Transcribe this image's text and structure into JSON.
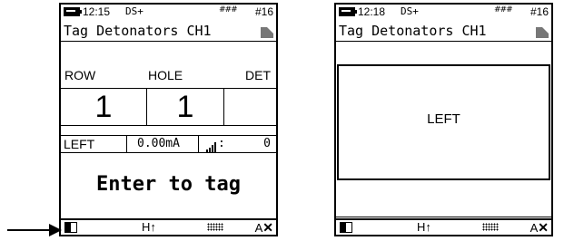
{
  "screen1": {
    "status": {
      "time": "12:15",
      "mode": "DS+",
      "signal": "###",
      "channel": "#16"
    },
    "title": "Tag Detonators CH1",
    "headers": {
      "row": "ROW",
      "hole": "HOLE",
      "det": "DET"
    },
    "values": {
      "row": "1",
      "hole": "1",
      "det": ""
    },
    "info": {
      "direction": "LEFT",
      "current": "0.00mA",
      "signal_count": "0"
    },
    "prompt": "Enter to tag",
    "softkeys": {
      "h": "H↑",
      "ax": "A",
      "ax_mark": "✕"
    }
  },
  "screen2": {
    "status": {
      "time": "12:18",
      "mode": "DS+",
      "signal": "###",
      "channel": "#16"
    },
    "title": "Tag Detonators CH1",
    "box_text": "LEFT",
    "softkeys": {
      "h": "H↑",
      "ax": "A",
      "ax_mark": "✕"
    }
  }
}
